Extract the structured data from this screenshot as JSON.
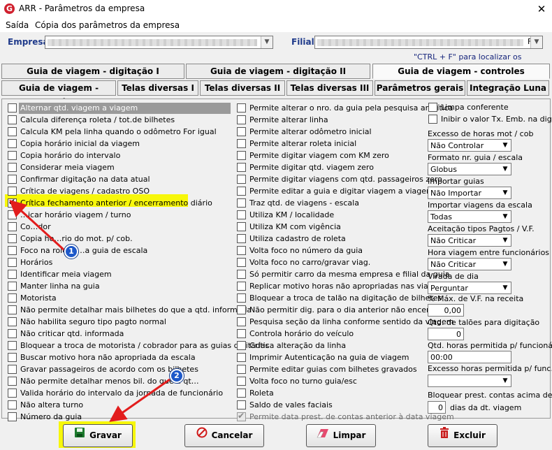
{
  "window": {
    "title": "ARR - Parâmetros da empresa",
    "close_glyph": "✕",
    "icon_letter": "G"
  },
  "menu": {
    "items": [
      "Saída",
      "Cópia dos parâmetros da empresa"
    ]
  },
  "header": {
    "empresa_label": "Empresa",
    "filial_label": "Filial",
    "hint": "\"CTRL + F\" para localizar os campos",
    "filial_visible_fragment": "F"
  },
  "tabs": {
    "row1": [
      "Guia de viagem - digitação I",
      "Guia de viagem - digitação II",
      "Guia de viagem - controles"
    ],
    "row2": [
      "Guia de viagem - receita",
      "Telas diversas I",
      "Telas diversas II",
      "Telas diversas III",
      "Parâmetros gerais",
      "Integração Luna"
    ],
    "active": "Guia de viagem - controles"
  },
  "col1": [
    {
      "label": "Alternar qtd. viagem a viagem",
      "checked": false
    },
    {
      "label": "Calcula diferença roleta / tot.de bilhetes",
      "checked": false
    },
    {
      "label": "Calcula KM pela linha quando o odômetro For igual",
      "checked": false
    },
    {
      "label": "Copia horário inicial da viagem",
      "checked": false
    },
    {
      "label": "Copia horário do intervalo",
      "checked": false
    },
    {
      "label": "Considerar meia viagem",
      "checked": false
    },
    {
      "label": "Confirmar digitação na data atual",
      "checked": false
    },
    {
      "label": "Crítica de viagens / cadastro OSO",
      "checked": false
    },
    {
      "label": "Crítica fechamento anterior / encerramento diário",
      "checked": true
    },
    {
      "label": "…icar horário viagem / turno",
      "checked": false
    },
    {
      "label": "Co…dor",
      "checked": false
    },
    {
      "label": "Copia ho…rio do mot. p/ cob.",
      "checked": false
    },
    {
      "label": "Foco na role…    …a guia de escala",
      "checked": false
    },
    {
      "label": "Horários",
      "checked": false
    },
    {
      "label": "Identificar meia viagem",
      "checked": false
    },
    {
      "label": "Manter linha na guia",
      "checked": false
    },
    {
      "label": "Motorista",
      "checked": false
    },
    {
      "label": "Não permite detalhar mais bilhetes do que a qtd. informada",
      "checked": false
    },
    {
      "label": "Não habilita seguro tipo pagto normal",
      "checked": false
    },
    {
      "label": "Não criticar qtd. informada",
      "checked": false
    },
    {
      "label": "Bloquear a troca de motorista / cobrador para as guias digitadas",
      "checked": false
    },
    {
      "label": "Buscar motivo hora não apropriada da escala",
      "checked": false
    },
    {
      "label": "Gravar passageiros de acordo com os bilhetes",
      "checked": false
    },
    {
      "label": "Não permite detalhar menos bil. do que a qt…",
      "checked": false
    },
    {
      "label": "Valida horário do intervalo da jornada de funcionário",
      "checked": false
    },
    {
      "label": "Não altera turno",
      "checked": false
    },
    {
      "label": "Número da guia",
      "checked": false
    }
  ],
  "col2": [
    {
      "label": "Permite alterar o nro. da guia pela pesquisa analítica",
      "checked": false
    },
    {
      "label": "Permite alterar linha",
      "checked": false
    },
    {
      "label": "Permite alterar odômetro inicial",
      "checked": false
    },
    {
      "label": "Permite alterar roleta inicial",
      "checked": false
    },
    {
      "label": "Permite digitar viagem com KM zero",
      "checked": false
    },
    {
      "label": "Permite digitar qtd. viagem zero",
      "checked": false
    },
    {
      "label": "Permite digitar viagens com qtd. passageiros zero",
      "checked": false
    },
    {
      "label": "Permite editar a guia e digitar viagem a viagem",
      "checked": false
    },
    {
      "label": "Traz qtd. de viagens - escala",
      "checked": false
    },
    {
      "label": "Utiliza KM / localidade",
      "checked": false
    },
    {
      "label": "Utiliza KM com vigência",
      "checked": false
    },
    {
      "label": "Utiliza cadastro de roleta",
      "checked": false
    },
    {
      "label": "Volta foco no número da guia",
      "checked": false
    },
    {
      "label": "Volta foco no carro/gravar viag.",
      "checked": false
    },
    {
      "label": "Só permitir carro  da mesma empresa e filial da guia",
      "checked": false
    },
    {
      "label": "Replicar motivo horas não apropriadas nas viagens",
      "checked": false
    },
    {
      "label": "Bloquear a troca de talão na digitação de bilhetes",
      "checked": false
    },
    {
      "label": "Não permitir dig. para o dia anterior não encerrado",
      "checked": false
    },
    {
      "label": "Pesquisa seção da linha conforme sentido da viagem",
      "checked": false
    },
    {
      "label": "Controla horário do veículo",
      "checked": false
    },
    {
      "label": "Crítica alteração da linha",
      "checked": false
    },
    {
      "label": "Imprimir Autenticação na guia de viagem",
      "checked": false
    },
    {
      "label": "Permite editar guias com bilhetes gravados",
      "checked": false
    },
    {
      "label": "Volta foco no turno guia/esc",
      "checked": false
    },
    {
      "label": "Roleta",
      "checked": false
    },
    {
      "label": "Saldo de vales faciais",
      "checked": false
    },
    {
      "label": "Permite data prest. de contas anterior à data viagem",
      "checked": true,
      "disabled": true
    }
  ],
  "col3": {
    "limpa_conferente": "Limpa conferente",
    "inibir": "Inibir o valor Tx. Emb. na dig.",
    "fields": [
      {
        "label": "Excesso de horas mot / cob",
        "value": "Não Controlar"
      },
      {
        "label": "Formato nr. guia / escala",
        "value": "Globus"
      },
      {
        "label": "Importar guias",
        "value": "Não Importar"
      },
      {
        "label": "Importar viagens  da escala",
        "value": "Todas"
      },
      {
        "label": "Aceitação tipos Pagtos / V.F.",
        "value": "Não Criticar"
      },
      {
        "label": "Hora viagem entre funcionários",
        "value": "Não Criticar"
      },
      {
        "label": "Virada de dia",
        "value": "Perguntar"
      }
    ],
    "pct_label": "% Máx. de V.F. na receita",
    "pct_value": "0,00",
    "taloes_label": "Qtd. de talões para digitação",
    "taloes_value": "0",
    "horas_label": "Qtd. horas permitida p/ funcionário",
    "horas_value": "00:00",
    "excesso_func_label": "Excesso horas permitida p/ func.",
    "excesso_func_value": "",
    "bloquear_label": "Bloquear prest. contas acima de",
    "bloquear_value": "0",
    "dias_label": "dias da dt. viagem"
  },
  "buttons": {
    "gravar": "Gravar",
    "cancelar": "Cancelar",
    "limpar": "Limpar",
    "excluir": "Excluir"
  },
  "annotations": {
    "badge1": "1",
    "badge2": "2"
  },
  "colors": {
    "highlight": "#f7f70a",
    "badge": "#1d58c9",
    "arrow": "#e21d1d",
    "header_label": "#1f3a8a"
  }
}
